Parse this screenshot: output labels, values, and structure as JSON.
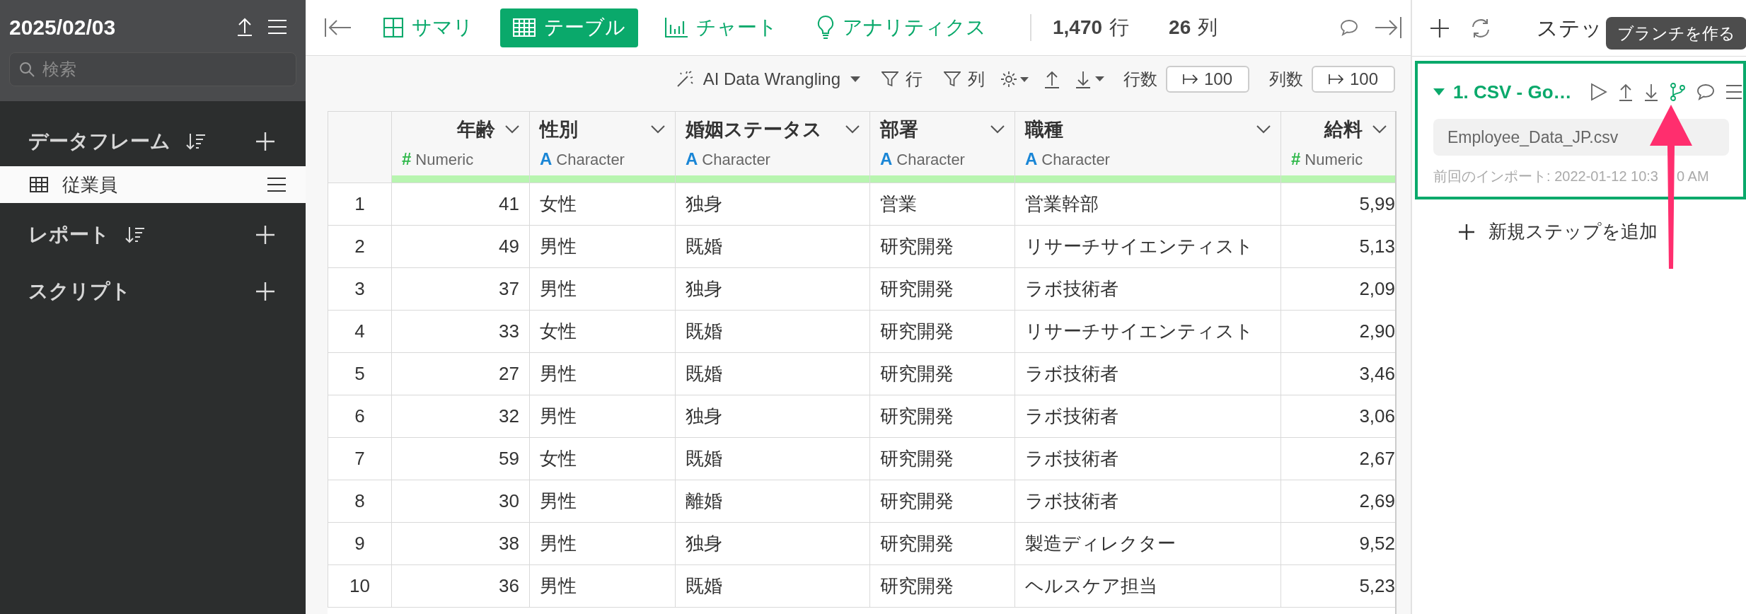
{
  "sidebar": {
    "title": "2025/02/03",
    "search": {
      "placeholder": "検索"
    },
    "sections": [
      {
        "label": "データフレーム",
        "sortable": true,
        "items": [
          {
            "label": "従業員",
            "selected": true
          }
        ]
      },
      {
        "label": "レポート",
        "sortable": true
      },
      {
        "label": "スクリプト",
        "sortable": false
      }
    ]
  },
  "view_tabs": [
    {
      "label": "サマリ",
      "kind": "summary",
      "selected": false
    },
    {
      "label": "テーブル",
      "kind": "table",
      "selected": true
    },
    {
      "label": "チャート",
      "kind": "chart",
      "selected": false
    },
    {
      "label": "アナリティクス",
      "kind": "analytics",
      "selected": false
    }
  ],
  "counts": [
    {
      "value": "1,470",
      "unit": "行"
    },
    {
      "value": "26",
      "unit": "列"
    }
  ],
  "toolbar": {
    "ai_button": "AI Data Wrangling",
    "row_filter": "行",
    "column_filter": "列",
    "row_limit": {
      "label": "行数",
      "value": "100"
    },
    "column_limit": {
      "label": "列数",
      "value": "100"
    }
  },
  "table": {
    "columns": [
      {
        "kind": "index"
      },
      {
        "name": "年齢",
        "kind": "numeric",
        "type_icon": "#",
        "type": "Numeric"
      },
      {
        "name": "性別",
        "kind": "character",
        "type_icon": "A",
        "type": "Character"
      },
      {
        "name": "婚姻ステータス",
        "kind": "character",
        "type_icon": "A",
        "type": "Character"
      },
      {
        "name": "部署",
        "kind": "character",
        "type_icon": "A",
        "type": "Character"
      },
      {
        "name": "職種",
        "kind": "character",
        "type_icon": "A",
        "type": "Character"
      },
      {
        "name": "給料",
        "kind": "numeric",
        "type_icon": "#",
        "type": "Numeric"
      }
    ],
    "rows": [
      [
        "1",
        "41",
        "女性",
        "独身",
        "営業",
        "営業幹部",
        "5,99"
      ],
      [
        "2",
        "49",
        "男性",
        "既婚",
        "研究開発",
        "リサーチサイエンティスト",
        "5,13"
      ],
      [
        "3",
        "37",
        "男性",
        "独身",
        "研究開発",
        "ラボ技術者",
        "2,09"
      ],
      [
        "4",
        "33",
        "女性",
        "既婚",
        "研究開発",
        "リサーチサイエンティスト",
        "2,90"
      ],
      [
        "5",
        "27",
        "男性",
        "既婚",
        "研究開発",
        "ラボ技術者",
        "3,46"
      ],
      [
        "6",
        "32",
        "男性",
        "独身",
        "研究開発",
        "ラボ技術者",
        "3,06"
      ],
      [
        "7",
        "59",
        "女性",
        "既婚",
        "研究開発",
        "ラボ技術者",
        "2,67"
      ],
      [
        "8",
        "30",
        "男性",
        "離婚",
        "研究開発",
        "ラボ技術者",
        "2,69"
      ],
      [
        "9",
        "38",
        "男性",
        "独身",
        "研究開発",
        "製造ディレクター",
        "9,52"
      ],
      [
        "10",
        "36",
        "男性",
        "既婚",
        "研究開発",
        "ヘルスケア担当",
        "5,23"
      ]
    ]
  },
  "steps_panel": {
    "title": "ステッ",
    "tooltip": "ブランチを作る",
    "steps": [
      {
        "title": "1. CSV - Go…",
        "expanded": true,
        "selected": true,
        "file": "Employee_Data_JP.csv",
        "import_time": [
          "前回のインポート: 2022-01-12 10:3",
          "0 AM"
        ]
      }
    ],
    "add_step": "新規ステップを追加"
  }
}
